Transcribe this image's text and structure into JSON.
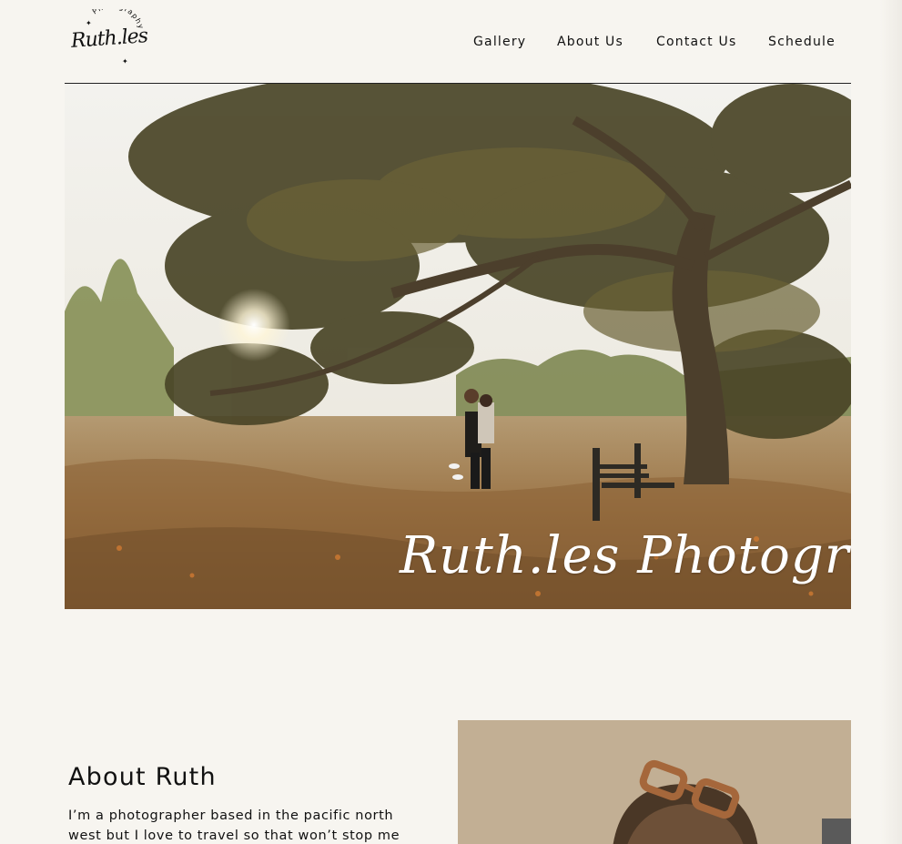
{
  "brand": {
    "logo_script": "Ruth.les",
    "logo_arc_text": "Photography"
  },
  "nav": {
    "items": [
      "Gallery",
      "About Us",
      "Contact Us",
      "Schedule"
    ]
  },
  "hero": {
    "overlay_text": "Ruth.les Photography"
  },
  "about": {
    "heading": "About Ruth",
    "body": "I’m a photographer based in the pacific north west but I love to travel so that won’t stop me"
  },
  "colors": {
    "background": "#f7f5f0",
    "text": "#111111",
    "accent_sunlight": "#f4e9c8",
    "grass": "#a07a4b"
  },
  "icons": {
    "logo": "logo-mark",
    "logo_stars": "star-icon"
  }
}
